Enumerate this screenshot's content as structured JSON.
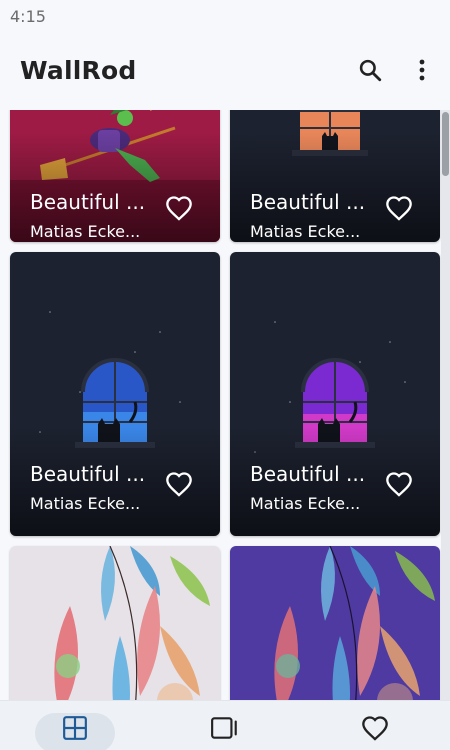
{
  "status_bar": {
    "time": "4:15"
  },
  "app_bar": {
    "title": "WallRod",
    "icons": [
      "search-icon",
      "more-vert-icon"
    ]
  },
  "wallpapers": [
    {
      "title": "Beautiful ...",
      "author": "Matias Ecke...",
      "art": "witch-on-broom"
    },
    {
      "title": "Beautiful ...",
      "author": "Matias Ecke...",
      "art": "cat-window-orange"
    },
    {
      "title": "Beautiful ...",
      "author": "Matias Ecke...",
      "art": "cat-window-blue"
    },
    {
      "title": "Beautiful ...",
      "author": "Matias Ecke...",
      "art": "cat-window-purple"
    },
    {
      "title": "",
      "author": "",
      "art": "leaves-light"
    },
    {
      "title": "",
      "author": "",
      "art": "leaves-purple"
    }
  ],
  "bottom_nav": {
    "items": [
      {
        "name": "grid-view",
        "icon": "grid-icon",
        "selected": true
      },
      {
        "name": "collections",
        "icon": "cards-icon",
        "selected": false
      },
      {
        "name": "favorites",
        "icon": "heart-outline-icon",
        "selected": false
      }
    ]
  },
  "colors": {
    "background": "#f7f8fc",
    "card_dark": "#1d2230",
    "card_red": "#9e1b45",
    "nav_pill": "#dde3ea",
    "accent_blue": "#1e5b96"
  }
}
